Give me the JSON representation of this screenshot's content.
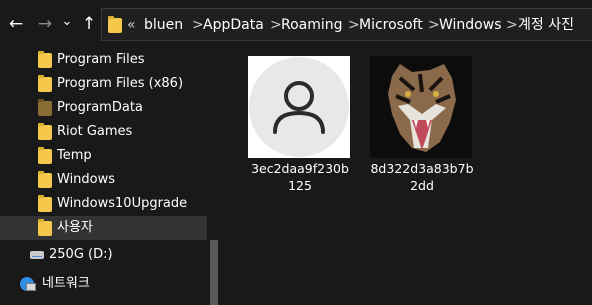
{
  "toolbar": {
    "back_icon": "←",
    "forward_icon": "→",
    "recent_icon": "⌄",
    "up_icon": "↑"
  },
  "address": {
    "overflow_icon": "«",
    "separator": ">",
    "crumbs": [
      "bluen",
      "AppData",
      "Roaming",
      "Microsoft",
      "Windows",
      "계정 사진"
    ]
  },
  "sidebar": {
    "items": [
      {
        "label": "Program Files"
      },
      {
        "label": "Program Files (x86)"
      },
      {
        "label": "ProgramData"
      },
      {
        "label": "Riot Games"
      },
      {
        "label": "Temp"
      },
      {
        "label": "Windows"
      },
      {
        "label": "Windows10Upgrade"
      },
      {
        "label": "사용자"
      }
    ],
    "drive": {
      "label": "250G (D:)"
    },
    "network": {
      "label": "네트워크"
    }
  },
  "files": [
    {
      "name": "3ec2daa9f230b125",
      "icon": "user-avatar"
    },
    {
      "name": "8d322d3a83b7b2dd",
      "icon": "tiger-photo"
    }
  ],
  "colors": {
    "background": "#191919",
    "folder": "#f5c84c",
    "selected": "#333333"
  }
}
